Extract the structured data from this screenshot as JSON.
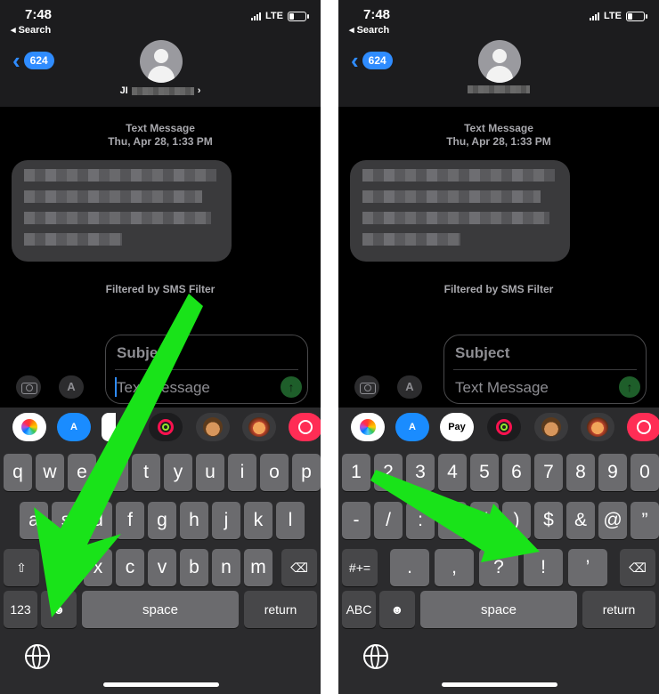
{
  "status": {
    "time": "7:48",
    "back_app": "◂ Search",
    "carrier": "LTE"
  },
  "header": {
    "unread_count": "624",
    "contact_left_visible": "JI",
    "contact_right_visible": ""
  },
  "conversation": {
    "meta_line1": "Text Message",
    "meta_line2": "Thu, Apr 28, 1:33 PM",
    "filtered_note": "Filtered by SMS Filter"
  },
  "compose": {
    "subject_placeholder": "Subject",
    "message_placeholder": "Text Message",
    "send_icon": "arrow-up-icon"
  },
  "app_strip": {
    "pay_label": " Pay",
    "icons": [
      "photos-icon",
      "app-store-icon",
      "apple-pay-icon",
      "activity-icon",
      "memoji-icon",
      "animoji-icon",
      "web-search-icon"
    ]
  },
  "keyboard_letters": {
    "row1": [
      "q",
      "w",
      "e",
      "r",
      "t",
      "y",
      "u",
      "i",
      "o",
      "p"
    ],
    "row2": [
      "a",
      "s",
      "d",
      "f",
      "g",
      "h",
      "j",
      "k",
      "l"
    ],
    "row3": [
      "z",
      "x",
      "c",
      "v",
      "b",
      "n",
      "m"
    ],
    "shift": "⇧",
    "delete": "⌫",
    "mode_key": "123",
    "emoji_key": "☻",
    "space": "space",
    "return": "return"
  },
  "keyboard_numbers": {
    "row1": [
      "1",
      "2",
      "3",
      "4",
      "5",
      "6",
      "7",
      "8",
      "9",
      "0"
    ],
    "row2": [
      "-",
      "/",
      ":",
      ";",
      "(",
      ")",
      "$",
      "&",
      "@",
      "”"
    ],
    "row3": [
      ".",
      ",",
      "?",
      "!",
      "’"
    ],
    "symbols_key": "#+=",
    "delete": "⌫",
    "mode_key": "ABC",
    "emoji_key": "☻",
    "space": "space",
    "return": "return"
  },
  "colors": {
    "accent": "#2f8cff",
    "annotation_arrow": "#19e319",
    "keyboard_bg": "#2b2b2d"
  }
}
